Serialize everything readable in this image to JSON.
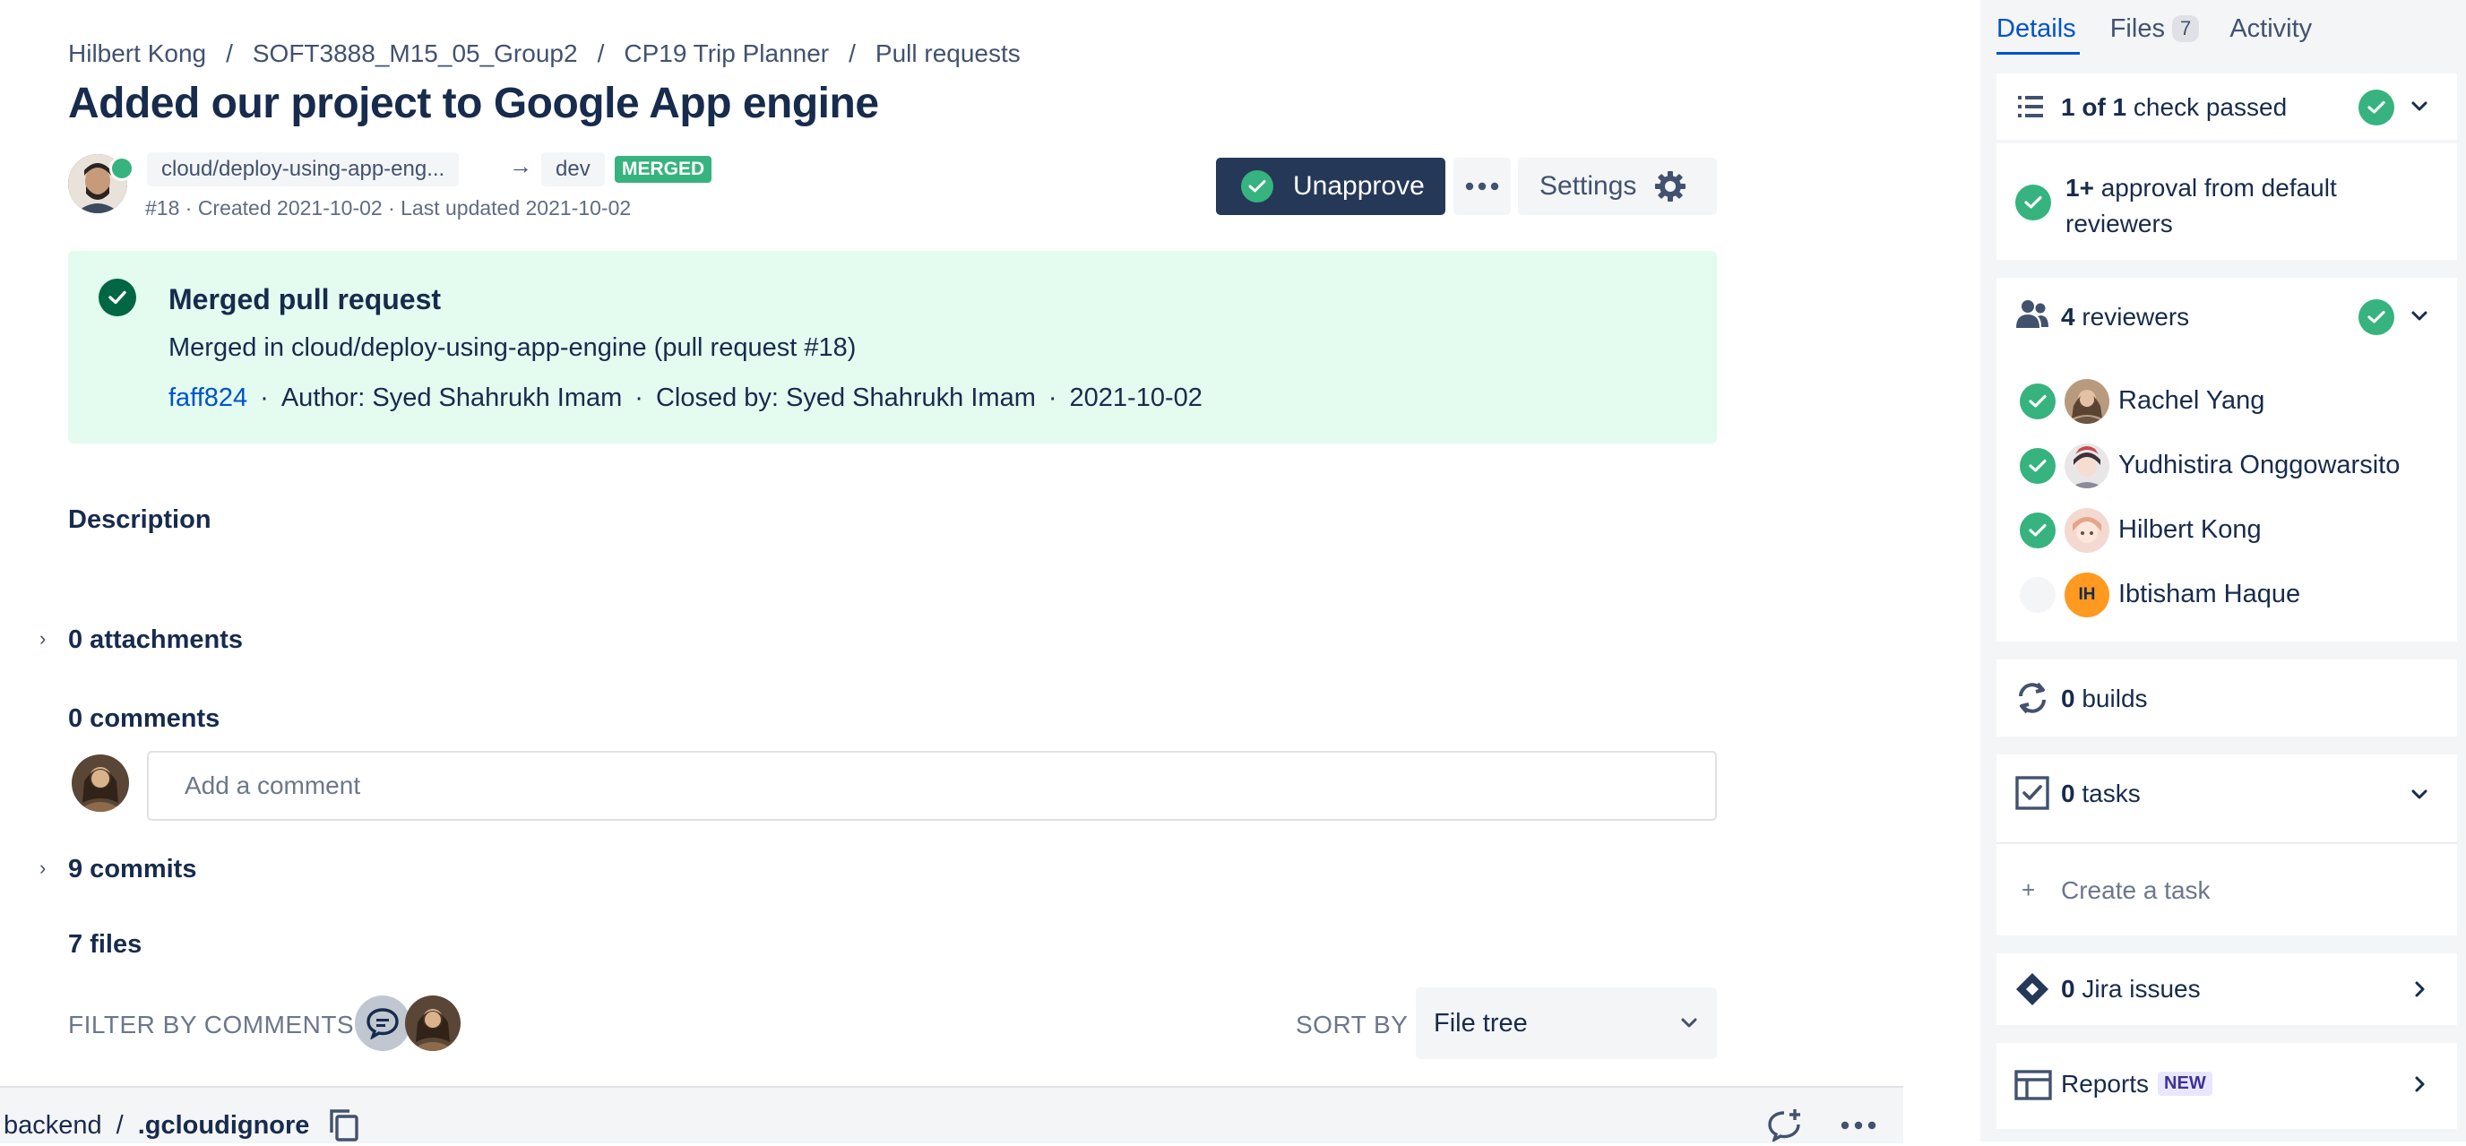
{
  "breadcrumb": [
    "Hilbert Kong",
    "SOFT3888_M15_05_Group2",
    "CP19 Trip Planner",
    "Pull requests"
  ],
  "breadcrumb_sep": "/",
  "pr": {
    "title": "Added our project to Google App engine",
    "source_branch": "cloud/deploy-using-app-eng...",
    "target_branch": "dev",
    "state": "MERGED",
    "meta": "#18 · Created 2021-10-02 · Last updated 2021-10-02"
  },
  "actions": {
    "unapprove": "Unapprove",
    "settings": "Settings"
  },
  "merged_panel": {
    "title": "Merged pull request",
    "line": "Merged in cloud/deploy-using-app-engine (pull request #18)",
    "commit": "faff824",
    "author": "Author: Syed Shahrukh Imam",
    "closed_by": "Closed by: Syed Shahrukh Imam",
    "date": "2021-10-02"
  },
  "description_heading": "Description",
  "attachments": "0 attachments",
  "comments_heading": "0 comments",
  "comment_placeholder": "Add a comment",
  "commits": "9 commits",
  "files_heading": "7 files",
  "filter_label": "FILTER BY COMMENTS",
  "sort_label": "SORT BY",
  "sort_value": "File tree",
  "file_path": {
    "dir": "backend",
    "sep": "/",
    "file": ".gcloudignore"
  },
  "sidebar": {
    "tabs": {
      "details": "Details",
      "files": "Files",
      "files_count": "7",
      "activity": "Activity"
    },
    "checks": {
      "count": "1 of 1",
      "text": "check passed"
    },
    "approval": {
      "bold": "1+",
      "text": "approval from default",
      "text2": "reviewers"
    },
    "reviewers": {
      "count": "4",
      "label": "reviewers",
      "list": [
        {
          "name": "Rachel Yang",
          "approved": true
        },
        {
          "name": "Yudhistira Onggowarsito",
          "approved": true
        },
        {
          "name": "Hilbert Kong",
          "approved": true
        },
        {
          "name": "Ibtisham Haque",
          "approved": false,
          "initials": "IH"
        }
      ]
    },
    "builds": {
      "count": "0",
      "label": "builds"
    },
    "tasks": {
      "count": "0",
      "label": "tasks",
      "create": "Create a task"
    },
    "jira": {
      "count": "0",
      "label": "Jira issues"
    },
    "reports": {
      "label": "Reports",
      "badge": "NEW"
    }
  },
  "colors": {
    "accent": "#0052cc",
    "success": "#36b37e",
    "merged_bg": "#e3fcef",
    "primary_button": "#253858"
  }
}
